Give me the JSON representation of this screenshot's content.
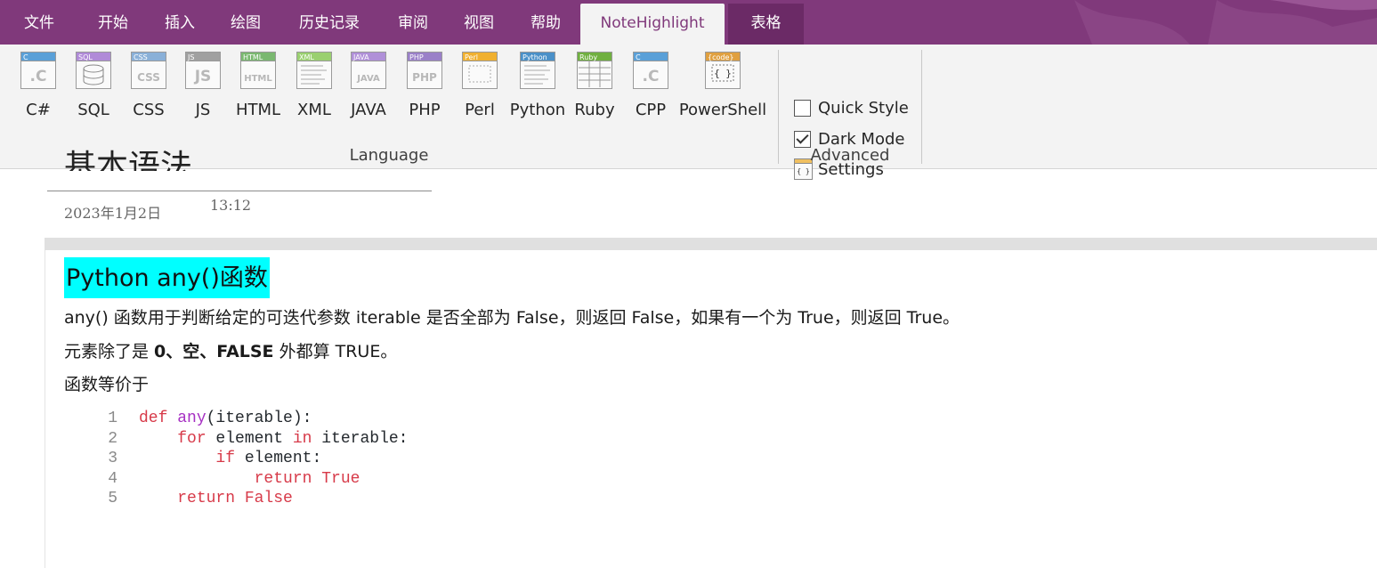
{
  "tabs": [
    {
      "label": "文件"
    },
    {
      "label": "开始"
    },
    {
      "label": "插入"
    },
    {
      "label": "绘图"
    },
    {
      "label": "历史记录"
    },
    {
      "label": "审阅"
    },
    {
      "label": "视图"
    },
    {
      "label": "帮助"
    },
    {
      "label": "NoteHighlight"
    },
    {
      "label": "表格"
    }
  ],
  "ribbon": {
    "languages": [
      {
        "label": "C#",
        "icon": "csharp-file-icon",
        "tag": "C",
        "glyph": ".C"
      },
      {
        "label": "SQL",
        "icon": "sql-database-icon",
        "tag": "SQL",
        "glyph": ""
      },
      {
        "label": "CSS",
        "icon": "css-file-icon",
        "tag": "CSS",
        "glyph": "CSS"
      },
      {
        "label": "JS",
        "icon": "js-file-icon",
        "tag": "JS",
        "glyph": "JS"
      },
      {
        "label": "HTML",
        "icon": "html-file-icon",
        "tag": "HTML",
        "glyph": "HTML"
      },
      {
        "label": "XML",
        "icon": "xml-file-icon",
        "tag": "XML",
        "glyph": ""
      },
      {
        "label": "JAVA",
        "icon": "java-file-icon",
        "tag": "JAVA",
        "glyph": "JAVA"
      },
      {
        "label": "PHP",
        "icon": "php-file-icon",
        "tag": "PHP",
        "glyph": "PHP"
      },
      {
        "label": "Perl",
        "icon": "perl-file-icon",
        "tag": "Perl",
        "glyph": ""
      },
      {
        "label": "Python",
        "icon": "python-file-icon",
        "tag": "Python",
        "glyph": ""
      },
      {
        "label": "Ruby",
        "icon": "ruby-table-icon",
        "tag": "Ruby",
        "glyph": ""
      },
      {
        "label": "CPP",
        "icon": "cpp-file-icon",
        "tag": "C",
        "glyph": ".C"
      },
      {
        "label": "PowerShell",
        "icon": "code-braces-icon",
        "tag": "{code}",
        "glyph": "{ }"
      }
    ],
    "language_group_label": "Language",
    "advanced": {
      "quick_style": {
        "label": "Quick Style",
        "checked": false
      },
      "dark_mode": {
        "label": "Dark Mode",
        "checked": true
      },
      "settings": {
        "label": "Settings",
        "icon": "settings-icon"
      }
    },
    "advanced_group_label": "Advanced"
  },
  "page": {
    "title": "基本语法",
    "date": "2023年1月2日",
    "time": "13:12"
  },
  "note": {
    "heading": "Python any()函数",
    "para1": "any() 函数用于判断给定的可迭代参数 iterable 是否全部为 False，则返回 False，如果有一个为 True，则返回 True。",
    "para2_prefix": "元素除了是 ",
    "para2_bold": "0、空、FALSE",
    "para2_suffix": " 外都算 TRUE。",
    "para3": "函数等价于"
  },
  "code": {
    "lines": [
      {
        "n": "1",
        "parts": [
          [
            "kw",
            "def "
          ],
          [
            "fn",
            "any"
          ],
          [
            "pl",
            "(iterable):"
          ]
        ]
      },
      {
        "n": "2",
        "parts": [
          [
            "pl",
            "    "
          ],
          [
            "kw",
            "for"
          ],
          [
            "pl",
            " element "
          ],
          [
            "kw",
            "in"
          ],
          [
            "pl",
            " iterable:"
          ]
        ]
      },
      {
        "n": "3",
        "parts": [
          [
            "pl",
            "        "
          ],
          [
            "kw",
            "if"
          ],
          [
            "pl",
            " element:"
          ]
        ]
      },
      {
        "n": "4",
        "parts": [
          [
            "pl",
            "            "
          ],
          [
            "kw",
            "return True"
          ]
        ]
      },
      {
        "n": "5",
        "parts": [
          [
            "pl",
            "    "
          ],
          [
            "kw",
            "return False"
          ]
        ]
      }
    ]
  },
  "colors": {
    "tab_bar": "#80397b",
    "ribbon": "#f3f3f3",
    "highlight": "#00ffff",
    "keyword": "#d73a49",
    "function": "#a630c3"
  }
}
